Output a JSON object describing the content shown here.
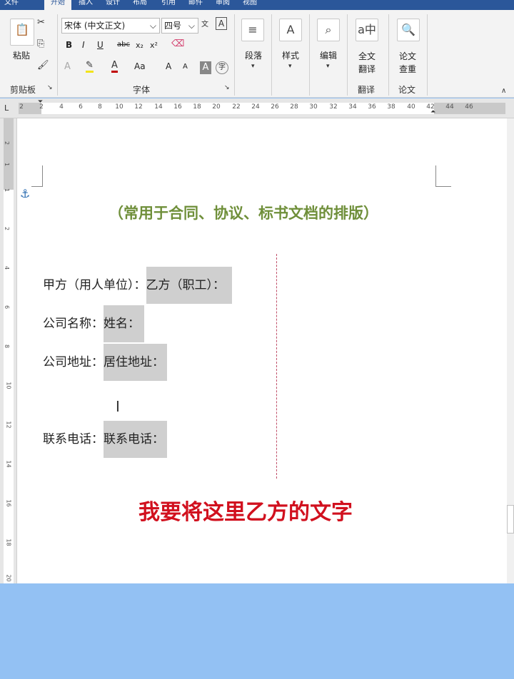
{
  "tabs": {
    "a": "文件",
    "b": "开始",
    "c": "插入",
    "d": "设计",
    "e": "布局",
    "f": "引用",
    "g": "邮件",
    "h": "审阅",
    "i": "视图"
  },
  "ribbon": {
    "clipboard": {
      "paste": "粘贴",
      "label": "剪贴板"
    },
    "font": {
      "name": "宋体 (中文正文)",
      "size": "四号",
      "label": "字体",
      "bold": "B",
      "italic": "I",
      "underline": "U",
      "strike": "abc",
      "subscript": "x₂",
      "superscript": "x²",
      "grow": "A",
      "shrink": "A",
      "case": "Aa"
    },
    "paragraph": {
      "label": "段落"
    },
    "styles": {
      "label": "样式"
    },
    "editing": {
      "label": "编辑"
    },
    "translate": {
      "full": "全文",
      "full2": "翻译",
      "label": "翻译"
    },
    "paper": {
      "check": "论文",
      "check2": "查重",
      "label": "论文"
    }
  },
  "ruler_marks": [
    "2",
    "2",
    "4",
    "6",
    "8",
    "10",
    "12",
    "14",
    "16",
    "18",
    "20",
    "22",
    "24",
    "26",
    "28",
    "30",
    "32",
    "34",
    "36",
    "38",
    "40",
    "42",
    "44",
    "46"
  ],
  "vruler_marks": [
    "2",
    "1",
    "1",
    "2",
    "4",
    "6",
    "8",
    "10",
    "12",
    "14",
    "16",
    "18",
    "20"
  ],
  "document": {
    "subtitle": "（常用于合同、协议、标书文档的排版）",
    "rows": [
      {
        "left": "甲方（用人单位）：",
        "right": "乙方（职工）："
      },
      {
        "left": "公司名称：",
        "right": "姓名："
      },
      {
        "left": "公司地址：",
        "right": "居住地址："
      },
      {
        "left": "联系电话：",
        "right": "联系电话："
      }
    ],
    "caption": "我要将这里乙方的文字"
  },
  "colors": {
    "title_bar": "#2b579a",
    "subtitle": "#6f8f3a",
    "caption": "#d1101e",
    "highlight": "#cfcfcf",
    "bottom_band": "#93c1f3"
  }
}
